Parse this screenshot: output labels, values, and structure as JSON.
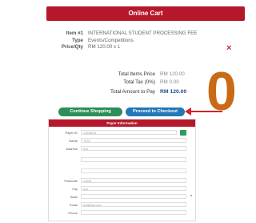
{
  "cart": {
    "title": "Online Cart",
    "item_label": "Item #1",
    "item_value": "INTERNATIONAL STUDENT PROCESSING FEE",
    "type_label": "Type",
    "type_value": "Events/Competitions",
    "price_label": "Price/Qty",
    "price_value": "RM 120.00 x 1",
    "total_items_label": "Total Items Price",
    "total_items_value": "RM 120.00",
    "total_tax_label": "Total Tax (0%)",
    "total_tax_value": "RM 0.00",
    "total_pay_label": "Total Amount to Pay",
    "total_pay_value": "RM 120.00",
    "continue_label": "Continue Shopping",
    "checkout_label": "Proceed to Checkout",
    "remove_symbol": "×"
  },
  "annotation": {
    "big_number": "0"
  },
  "payer": {
    "title": "Payer Information",
    "fields": [
      {
        "label": "Payer ID",
        "value": "12345678"
      },
      {
        "label": "Name",
        "value": "TEST"
      },
      {
        "label": "Address",
        "value": "test"
      },
      {
        "label": "",
        "value": ""
      },
      {
        "label": "",
        "value": ""
      },
      {
        "label": "Postcode",
        "value": "12345"
      },
      {
        "label": "City",
        "value": "test"
      },
      {
        "label": "State",
        "value": ""
      },
      {
        "label": "Email",
        "value": "test@test.com"
      },
      {
        "label": "Phone",
        "value": ""
      }
    ]
  },
  "colors": {
    "header": "#b5182b",
    "continue": "#2b8f57",
    "checkout": "#2378b8",
    "arrow": "#d2232a",
    "zero": "#c96a14"
  }
}
